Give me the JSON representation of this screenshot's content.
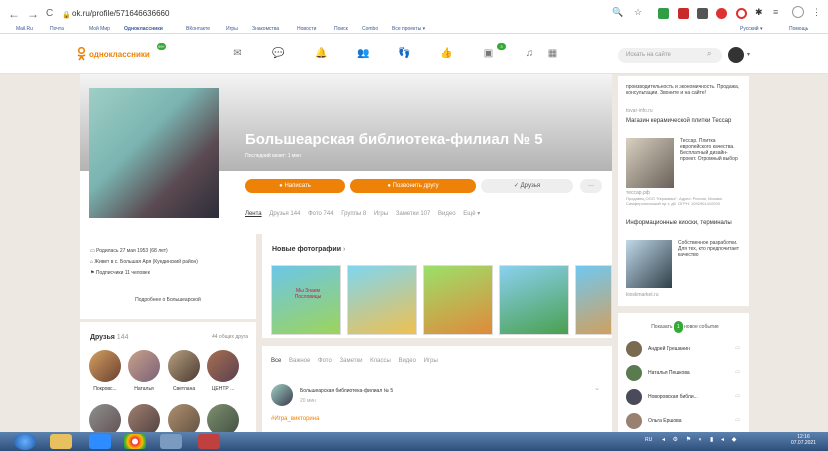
{
  "browser": {
    "url": "ok.ru/profile/571646636660",
    "back": "←",
    "forward": "→",
    "reload": "C"
  },
  "bookmarks": [
    "Mail.Ru",
    "Почта",
    "Мой Мир",
    "Одноклассники",
    "ВКонтакте",
    "Игры",
    "Знакомства",
    "Новости",
    "Поиск",
    "Combo",
    "Все проекты ▾"
  ],
  "bookmarks_right": [
    "Русский ▾",
    "Помощь"
  ],
  "header": {
    "logo": "одноклассники",
    "search_placeholder": "Искать на сайте",
    "badge_notes": "99+",
    "badge_guests": "3"
  },
  "profile": {
    "name": "Большеарская библиотека-филиал № 5",
    "last_visit": "Последний визит: 1 мин",
    "write_btn": "Написать",
    "add_friend_btn": "Позвонить другу",
    "friends_btn": "✓ Друзья",
    "more_btn": "···"
  },
  "tabs": [
    {
      "label": "Лента"
    },
    {
      "label": "Друзья 144"
    },
    {
      "label": "Фото 744"
    },
    {
      "label": "Группы 8"
    },
    {
      "label": "Игры"
    },
    {
      "label": "Заметки 107"
    },
    {
      "label": "Видео"
    },
    {
      "label": "Ещё ▾"
    }
  ],
  "info": {
    "born": "Родилась 27 мая 1953 (68 лет)",
    "lives": "Живет в с. Большая Аря (Куединский район)",
    "subscribers": "Подписчики 11 человек",
    "more": "Подробнее о Большеарской"
  },
  "friends": {
    "title": "Друзья",
    "count": "144",
    "common": "44 общих друга",
    "list": [
      "Покровс...",
      "Наталья",
      "Светлана",
      "ЦЕНТР ..."
    ]
  },
  "photos": {
    "title": "Новые фотографии",
    "arrow": "›",
    "thumbs": [
      "Мы Знаем Пословицы",
      "",
      "",
      "",
      ""
    ]
  },
  "feed": {
    "tabs": [
      "Все",
      "Важное",
      "Фото",
      "Заметки",
      "Классы",
      "Видео",
      "Игры"
    ],
    "author": "Большеарская библиотека-филиал № 5",
    "time": "20 мин",
    "tag": "#Игра_викторина"
  },
  "ads": {
    "ad1_text": "производительность и экономичность. Продажа, консультации. Звоните и на сайте!",
    "ad1_site": "tovar-info.ru",
    "ad2_title": "Магазин керамической плитки Тессар",
    "ad2_text": "Тессар. Плитка европейского качества. Бесплатный дизайн-проект. Огромный выбор",
    "ad2_site": "тессар.рф",
    "ad2_legal": "Продавец ООО \"Керамика\", Адрес: Россия, Москва, Симферопольский пр-т, д5. ОГРН: 1092901410200",
    "ad3_title": "Информационные киоски, терминалы",
    "ad3_text": "Собственное разработки. Для тех, кто предпочитает качество",
    "ad3_site": "kioskmarket.ru"
  },
  "events": {
    "show": "Показать",
    "new_count": "1",
    "new_label": "новое событие",
    "list": [
      "Андрей Грешанин",
      "Наталья Пешкова",
      "Новоровская библи...",
      "Ольга Ершова"
    ]
  },
  "taskbar": {
    "lang": "RU",
    "time": "12:16",
    "date": "07.07.2021"
  },
  "colors": {
    "ok_orange": "#ee8208",
    "green_badge": "#33aa33",
    "taskbar": "#2e4f7a"
  }
}
